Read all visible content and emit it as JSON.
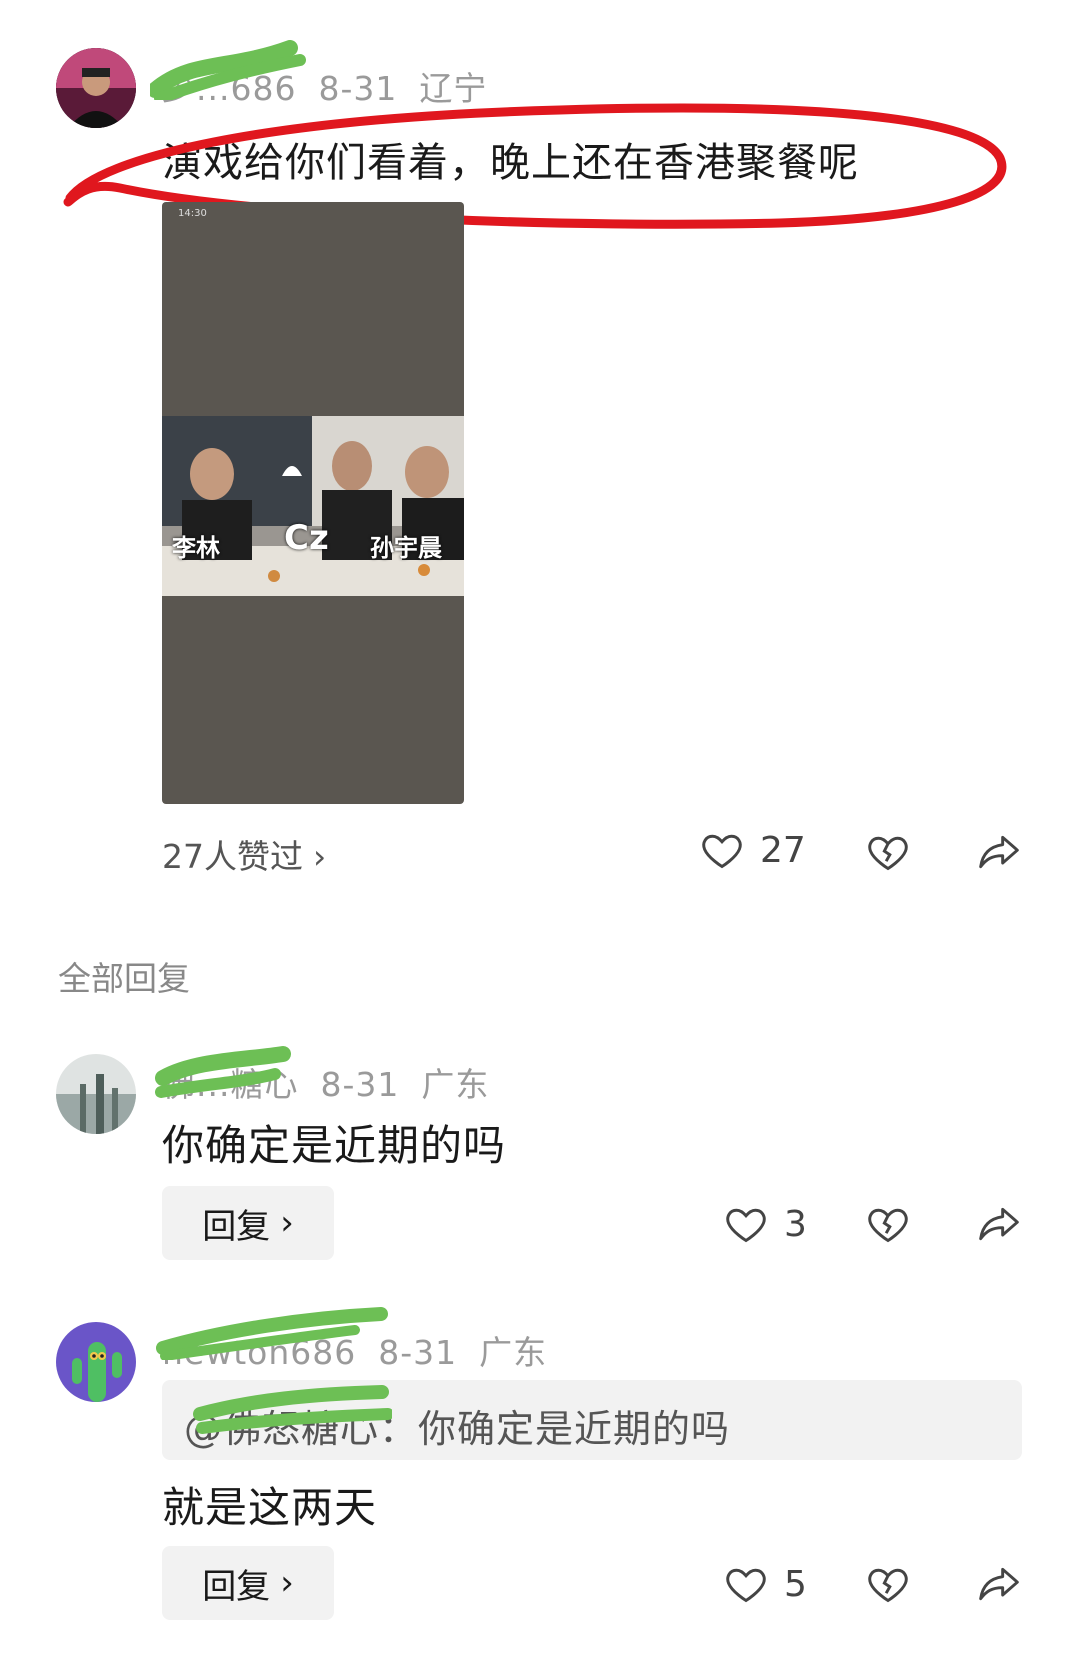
{
  "comment1": {
    "username_visible": "少...686",
    "date": "8-31",
    "location": "辽宁",
    "text": "演戏给你们看着，晚上还在香港聚餐呢",
    "image_labels": [
      "李林",
      "Cz",
      "孙宇晨"
    ],
    "image_status_time": "14:30",
    "liked_by": "27人赞过",
    "like_count": "27"
  },
  "section_title": "全部回复",
  "reply1": {
    "username_visible": "佛...糖心",
    "date": "8-31",
    "location": "广东",
    "text": "你确定是近期的吗",
    "reply_label": "回复",
    "like_count": "3"
  },
  "reply2": {
    "username_visible": "newton686",
    "date": "8-31",
    "location": "广东",
    "quote_mention": "@佛怒糖心",
    "quote_text": "：你确定是近期的吗",
    "text": "就是这两天",
    "reply_label": "回复",
    "like_count": "5"
  },
  "colors": {
    "highlight_red": "#e0171e",
    "scribble_green": "#6dbf55"
  },
  "icons": [
    "heart-icon",
    "broken-heart-icon",
    "share-icon",
    "chevron-right-icon"
  ]
}
